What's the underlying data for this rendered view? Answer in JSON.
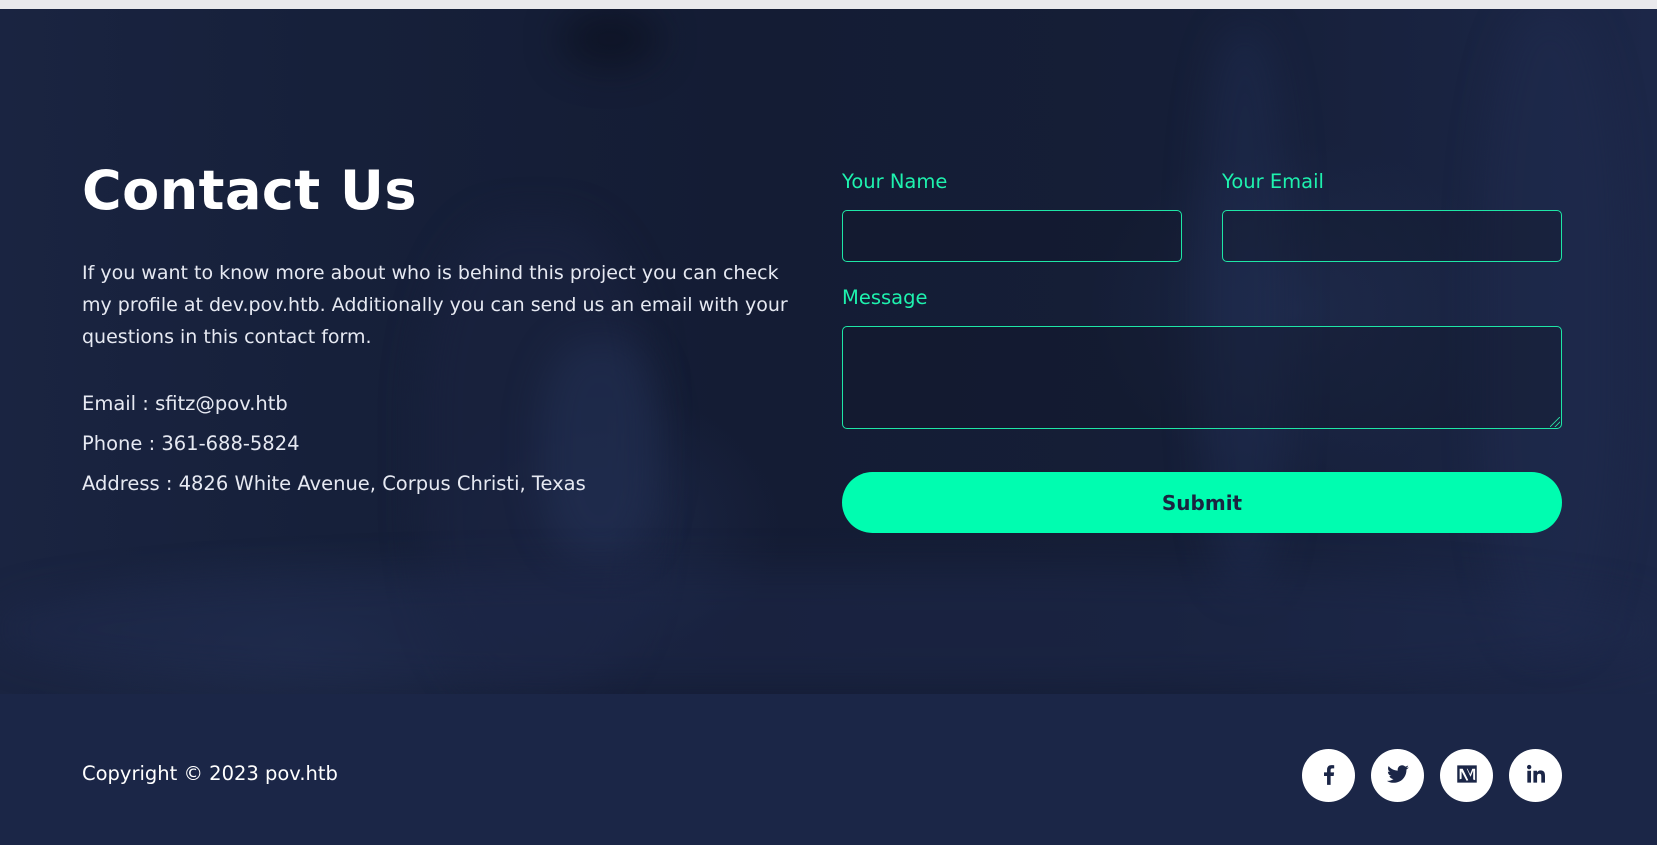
{
  "contact": {
    "title": "Contact Us",
    "intro": "If you want to know more about who is behind this project you can check my profile at dev.pov.htb. Additionally you can send us an email with your questions in this contact form.",
    "email_line": "Email : sfitz@pov.htb",
    "phone_line": "Phone : 361-688-5824",
    "address_line": "Address : 4826 White Avenue, Corpus Christi, Texas"
  },
  "form": {
    "name_label": "Your Name",
    "name_value": "",
    "email_label": "Your Email",
    "email_value": "",
    "message_label": "Message",
    "message_value": "",
    "submit_label": "Submit"
  },
  "footer": {
    "copyright": "Copyright © 2023 pov.htb",
    "social_icons": [
      "facebook-icon",
      "twitter-icon",
      "medium-icon",
      "linkedin-icon"
    ]
  },
  "colors": {
    "accent": "#00fdb0",
    "label": "#1ef2ae",
    "footer_bg": "#1b2647",
    "section_bg": "#151e37"
  }
}
